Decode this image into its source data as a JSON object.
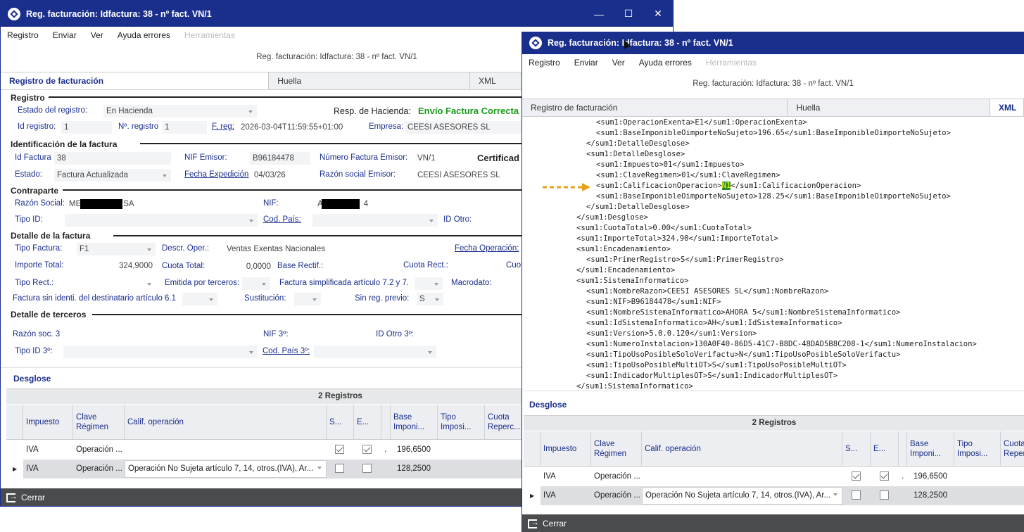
{
  "w1": {
    "title": "Reg. facturación: Idfactura: 38 - nº fact. VN/1",
    "menu": [
      "Registro",
      "Enviar",
      "Ver",
      "Ayuda errores",
      "Herramientas"
    ],
    "subtitle": "Reg. facturación: Idfactura: 38 - nº fact. VN/1",
    "tabs": [
      "Registro de facturación",
      "Huella",
      "XML"
    ],
    "registro": {
      "section": "Registro",
      "estado_lbl": "Estado del registro:",
      "estado_val": "En Hacienda",
      "resp_lbl": "Resp. de Hacienda:",
      "resp_val": "Envío Factura Correcta",
      "idreg_lbl": "Id registro:",
      "idreg_val": "1",
      "nreg_lbl": "Nº. registro",
      "nreg_val": "1",
      "freg_lbl": "F. reg:",
      "freg_val": "2026-03-04T11:59:55+01:00",
      "empresa_lbl": "Empresa:",
      "empresa_val": "CEESI ASESORES SL"
    },
    "ident": {
      "section": "Identificación de la factura",
      "idfac_lbl": "Id Factura",
      "idfac_val": "38",
      "nif_lbl": "NIF Emisor:",
      "nif_val": "B96184478",
      "num_lbl": "Número Factura Emisor:",
      "num_val": "VN/1",
      "cert": "Certificad",
      "estado_lbl": "Estado:",
      "estado_val": "Factura Actualizada",
      "fexp_lbl": "Fecha Expedición",
      "fexp_val": "04/03/26",
      "razon_lbl": "Razón social Emisor:",
      "razon_val": "CEESI ASESORES SL"
    },
    "contra": {
      "section": "Contraparte",
      "razon_lbl": "Razón Social:",
      "razon_pre": "ME",
      "razon_post": "SA",
      "nif_lbl": "NIF:",
      "nif_pre": "A",
      "nif_post": "4",
      "tipoid_lbl": "Tipo ID:",
      "codpais_lbl": "Cod. País:",
      "idotro_lbl": "ID Otro:"
    },
    "detalle": {
      "section": "Detalle de la factura",
      "tipo_lbl": "Tipo Factura:",
      "tipo_val": "F1",
      "desc_lbl": "Descr. Oper.:",
      "desc_val": "Ventas Exentas Nacionales",
      "fop_lbl": "Fecha Operación:",
      "imp_lbl": "Importe Total:",
      "imp_val": "324,9000",
      "cuota_lbl": "Cuota Total:",
      "cuota_val": "0,0000",
      "base_lbl": "Base Rectif.:",
      "cuotar_lbl": "Cuota Rect.:",
      "cuo_lbl": "Cuot",
      "tiporect_lbl": "Tipo Rect.:",
      "emit_lbl": "Emitida por terceros:",
      "simp_lbl": "Factura simplificada artículo 7.2 y 7.",
      "macro_lbl": "Macrodato:",
      "sinid_lbl": "Factura sin identi. del destinatario artículo 6.1",
      "sust_lbl": "Sustitución:",
      "sinreg_lbl": "Sin reg. previo:",
      "sinreg_val": "S"
    },
    "terceros": {
      "section": "Detalle de terceros",
      "razon_lbl": "Razón soc. 3",
      "nif_lbl": "NIF 3º:",
      "idotro_lbl": "ID Otro 3º:",
      "tipoid_lbl": "Tipo ID 3º:",
      "codpais_lbl": "Cod. País 3º:"
    },
    "desglose": {
      "section": "Desglose",
      "count": "2 Registros",
      "headers": [
        "Impuesto",
        "Clave Régimen",
        "Calif. operación",
        "S...",
        "E...",
        "",
        "Base Imponi...",
        "Tipo Imposi...",
        "Cuota Reperc..."
      ],
      "rows": [
        [
          "IVA",
          "Operación ...",
          "",
          ".",
          "196,6500"
        ],
        [
          "IVA",
          "Operación ...",
          "Operación No Sujeta artículo 7, 14, otros.(IVA), Ar...",
          "",
          "128,2500"
        ]
      ]
    },
    "close": "Cerrar"
  },
  "w2": {
    "title": "Reg. facturación: Idfactura: 38 - nº fact. VN/1",
    "menu": [
      "Registro",
      "Enviar",
      "Ver",
      "Ayuda errores",
      "Herramientas"
    ],
    "subtitle": "Reg. facturación: Idfactura: 38 - nº fact. VN/1",
    "tabs": [
      "Registro de facturación",
      "Huella",
      "XML"
    ],
    "xml": [
      "<sum1:OperacionExenta>E1</sum1:OperacionExenta>",
      "<sum1:BaseImponibleOimporteNoSujeto>196.65</sum1:BaseImponibleOimporteNoSujeto>",
      "</sum1:DetalleDesglose>",
      "<sum1:DetalleDesglose>",
      "<sum1:Impuesto>01</sum1:Impuesto>",
      "<sum1:ClaveRegimen>01</sum1:ClaveRegimen>",
      "<sum1:CalificacionOperacion>",
      "N1",
      "</sum1:CalificacionOperacion>",
      "<sum1:BaseImponibleOimporteNoSujeto>128.25</sum1:BaseImponibleOimporteNoSujeto>",
      "</sum1:DetalleDesglose>",
      "</sum1:Desglose>",
      "<sum1:CuotaTotal>0.00</sum1:CuotaTotal>",
      "<sum1:ImporteTotal>324.90</sum1:ImporteTotal>",
      "<sum1:Encadenamiento>",
      "<sum1:PrimerRegistro>S</sum1:PrimerRegistro>",
      "</sum1:Encadenamiento>",
      "<sum1:SistemaInformatico>",
      "<sum1:NombreRazon>CEESI ASESORES SL</sum1:NombreRazon>",
      "<sum1:NIF>B96184478</sum1:NIF>",
      "<sum1:NombreSistemaInformatico>AHORA 5</sum1:NombreSistemaInformatico>",
      "<sum1:IdSistemaInformatico>AH</sum1:IdSistemaInformatico>",
      "<sum1:Version>5.0.0.120</sum1:Version>",
      "<sum1:NumeroInstalacion>130A0F40-86D5-41C7-B8DC-48DAD5B8C208-1</sum1:NumeroInstalacion>",
      "<sum1:TipoUsoPosibleSoloVerifactu>N</sum1:TipoUsoPosibleSoloVerifactu>",
      "<sum1:TipoUsoPosibleMultiOT>S</sum1:TipoUsoPosibleMultiOT>",
      "<sum1:IndicadorMultiplesOT>S</sum1:IndicadorMultiplesOT>",
      "</sum1:SistemaInformatico>"
    ],
    "desglose": {
      "section": "Desglose",
      "count": "2 Registros",
      "headers": [
        "Impuesto",
        "Clave Régimen",
        "Calif. operación",
        "S...",
        "E...",
        "",
        "Base Imponi...",
        "Tipo Imposi...",
        "Cuota Reperc..."
      ],
      "rows": [
        [
          "IVA",
          "Operación ...",
          "",
          ".",
          "196,6500"
        ],
        [
          "IVA",
          "Operación ...",
          "Operación No Sujeta artículo 7, 14, otros.(IVA), Ar...",
          "",
          "128,2500"
        ]
      ]
    },
    "close": "Cerrar"
  },
  "colors": {
    "titlebar": "#1a2e8c",
    "label": "#1a2e8c",
    "green": "#1a9a1a",
    "footer": "#4a4b4d",
    "highlight": "#2e8b2e",
    "arrow": "#e6a21e"
  }
}
